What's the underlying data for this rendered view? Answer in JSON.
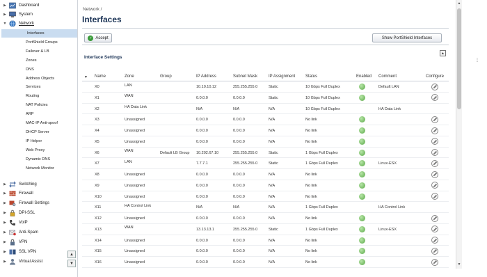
{
  "sidebar": {
    "top_items": [
      {
        "label": "Dashboard",
        "icon": "dashboard-icon",
        "expanded": false
      },
      {
        "label": "System",
        "icon": "system-icon",
        "expanded": false
      },
      {
        "label": "Network",
        "icon": "network-icon",
        "expanded": true
      }
    ],
    "network_children": [
      "Interfaces",
      "PortShield Groups",
      "Failover & LB",
      "Zones",
      "DNS",
      "Address Objects",
      "Services",
      "Routing",
      "NAT Policies",
      "ARP",
      "MAC-IP Anti-spoof",
      "DHCP Server",
      "IP Helper",
      "Web Proxy",
      "Dynamic DNS",
      "Network Monitor"
    ],
    "active_child": "Interfaces",
    "bottom_items": [
      {
        "label": "Switching",
        "icon": "switching-icon"
      },
      {
        "label": "Firewall",
        "icon": "firewall-icon"
      },
      {
        "label": "Firewall Settings",
        "icon": "firewall-settings-icon"
      },
      {
        "label": "DPI-SSL",
        "icon": "dpi-ssl-icon"
      },
      {
        "label": "VoIP",
        "icon": "voip-icon"
      },
      {
        "label": "Anti-Spam",
        "icon": "anti-spam-icon"
      },
      {
        "label": "VPN",
        "icon": "vpn-icon"
      },
      {
        "label": "SSL VPN",
        "icon": "ssl-vpn-icon"
      },
      {
        "label": "Virtual Assist",
        "icon": "virtual-assist-icon"
      }
    ],
    "scroll_up": "▲",
    "scroll_down": "▼"
  },
  "header": {
    "breadcrumb": "Network /",
    "title": "Interfaces"
  },
  "toolbar": {
    "accept_label": "Accept",
    "portshield_label": "Show PortShield Interfaces"
  },
  "section": {
    "title": "Interface Settings",
    "collapse_glyph": "▲"
  },
  "table": {
    "columns": [
      "Name",
      "Zone",
      "Group",
      "IP Address",
      "Subnet Mask",
      "IP Assignment",
      "Status",
      "Enabled",
      "Comment",
      "Configure"
    ],
    "sort_glyph": "▼",
    "rows": [
      {
        "name": "X0",
        "zone": "LAN",
        "group": "",
        "ip": "10.10.10.12",
        "mask": "255.255.255.0",
        "assign": "Static",
        "status": "10 Gbps Full Duplex",
        "enabled": true,
        "comment": "Default LAN",
        "configure": true
      },
      {
        "name": "X1",
        "zone": "WAN",
        "group": "",
        "ip": "0.0.0.0",
        "mask": "0.0.0.0",
        "assign": "Static",
        "status": "10 Gbps Full Duplex",
        "enabled": true,
        "comment": "",
        "configure": true
      },
      {
        "name": "X2",
        "zone": "HA Data Link",
        "group": "",
        "ip": "N/A",
        "mask": "N/A",
        "assign": "N/A",
        "status": "10 Gbps Full Duplex",
        "enabled": false,
        "comment": "HA Data Link",
        "configure": false
      },
      {
        "name": "X3",
        "zone": "Unassigned",
        "group": "",
        "ip": "0.0.0.0",
        "mask": "0.0.0.0",
        "assign": "N/A",
        "status": "No link",
        "enabled": true,
        "comment": "",
        "configure": true
      },
      {
        "name": "X4",
        "zone": "Unassigned",
        "group": "",
        "ip": "0.0.0.0",
        "mask": "0.0.0.0",
        "assign": "N/A",
        "status": "No link",
        "enabled": true,
        "comment": "",
        "configure": true
      },
      {
        "name": "X5",
        "zone": "Unassigned",
        "group": "",
        "ip": "0.0.0.0",
        "mask": "0.0.0.0",
        "assign": "N/A",
        "status": "No link",
        "enabled": true,
        "comment": "",
        "configure": true
      },
      {
        "name": "X6",
        "zone": "WAN",
        "group": "Default LB Group",
        "ip": "10.202.67.10",
        "mask": "255.255.255.0",
        "assign": "Static",
        "status": "1 Gbps Full Duplex",
        "enabled": true,
        "comment": "",
        "configure": true
      },
      {
        "name": "X7",
        "zone": "LAN",
        "group": "",
        "ip": "7.7.7.1",
        "mask": "255.255.255.0",
        "assign": "Static",
        "status": "1 Gbps Full Duplex",
        "enabled": true,
        "comment": "Linux-ESX",
        "configure": true
      },
      {
        "name": "X8",
        "zone": "Unassigned",
        "group": "",
        "ip": "0.0.0.0",
        "mask": "0.0.0.0",
        "assign": "N/A",
        "status": "No link",
        "enabled": true,
        "comment": "",
        "configure": true
      },
      {
        "name": "X9",
        "zone": "Unassigned",
        "group": "",
        "ip": "0.0.0.0",
        "mask": "0.0.0.0",
        "assign": "N/A",
        "status": "No link",
        "enabled": true,
        "comment": "",
        "configure": true
      },
      {
        "name": "X10",
        "zone": "Unassigned",
        "group": "",
        "ip": "0.0.0.0",
        "mask": "0.0.0.0",
        "assign": "N/A",
        "status": "No link",
        "enabled": true,
        "comment": "",
        "configure": true
      },
      {
        "name": "X11",
        "zone": "HA Control Link",
        "group": "",
        "ip": "N/A",
        "mask": "N/A",
        "assign": "N/A",
        "status": "1 Gbps Full Duplex",
        "enabled": false,
        "comment": "HA Control Link",
        "configure": false
      },
      {
        "name": "X12",
        "zone": "Unassigned",
        "group": "",
        "ip": "0.0.0.0",
        "mask": "0.0.0.0",
        "assign": "N/A",
        "status": "No link",
        "enabled": true,
        "comment": "",
        "configure": true
      },
      {
        "name": "X13",
        "zone": "WAN",
        "group": "",
        "ip": "13.13.13.1",
        "mask": "255.255.255.0",
        "assign": "Static",
        "status": "1 Gbps Full Duplex",
        "enabled": true,
        "comment": "Linux-ESX",
        "configure": true
      },
      {
        "name": "X14",
        "zone": "Unassigned",
        "group": "",
        "ip": "0.0.0.0",
        "mask": "0.0.0.0",
        "assign": "N/A",
        "status": "No link",
        "enabled": true,
        "comment": "",
        "configure": true
      },
      {
        "name": "X15",
        "zone": "Unassigned",
        "group": "",
        "ip": "0.0.0.0",
        "mask": "0.0.0.0",
        "assign": "N/A",
        "status": "No link",
        "enabled": true,
        "comment": "",
        "configure": true
      },
      {
        "name": "X16",
        "zone": "Unassigned",
        "group": "",
        "ip": "0.0.0.0",
        "mask": "0.0.0.0",
        "assign": "N/A",
        "status": "No link",
        "enabled": true,
        "comment": "",
        "configure": true
      }
    ]
  },
  "colors": {
    "accent": "#1d3557",
    "active_bg": "#c9dcf0",
    "enabled_green": "#5aa848"
  }
}
